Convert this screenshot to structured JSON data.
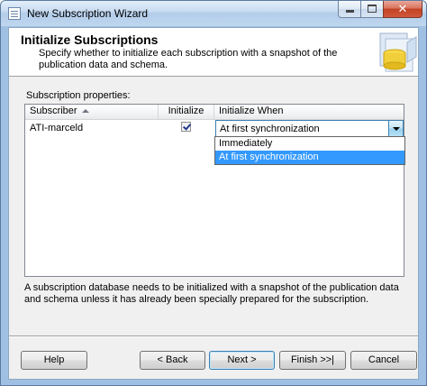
{
  "window": {
    "title": "New Subscription Wizard"
  },
  "header": {
    "title": "Initialize Subscriptions",
    "description": "Specify whether to initialize each subscription with a snapshot of the publication data and schema."
  },
  "properties": {
    "label": "Subscription properties:",
    "columns": {
      "subscriber": "Subscriber",
      "initialize": "Initialize",
      "initialize_when": "Initialize When"
    },
    "rows": [
      {
        "subscriber": "ATI-marceld",
        "initialize": true,
        "initialize_when": "At first synchronization"
      }
    ],
    "dropdown_options": [
      "Immediately",
      "At first synchronization"
    ],
    "dropdown_selected": "At first synchronization"
  },
  "note": "A subscription database needs to be initialized with a snapshot of the publication data and schema unless it has already been specially prepared for the subscription.",
  "buttons": {
    "help": "Help",
    "back": "< Back",
    "next": "Next >",
    "finish": "Finish >>|",
    "cancel": "Cancel"
  },
  "colors": {
    "selection": "#3399ff",
    "focus_border": "#3c7fb1"
  }
}
